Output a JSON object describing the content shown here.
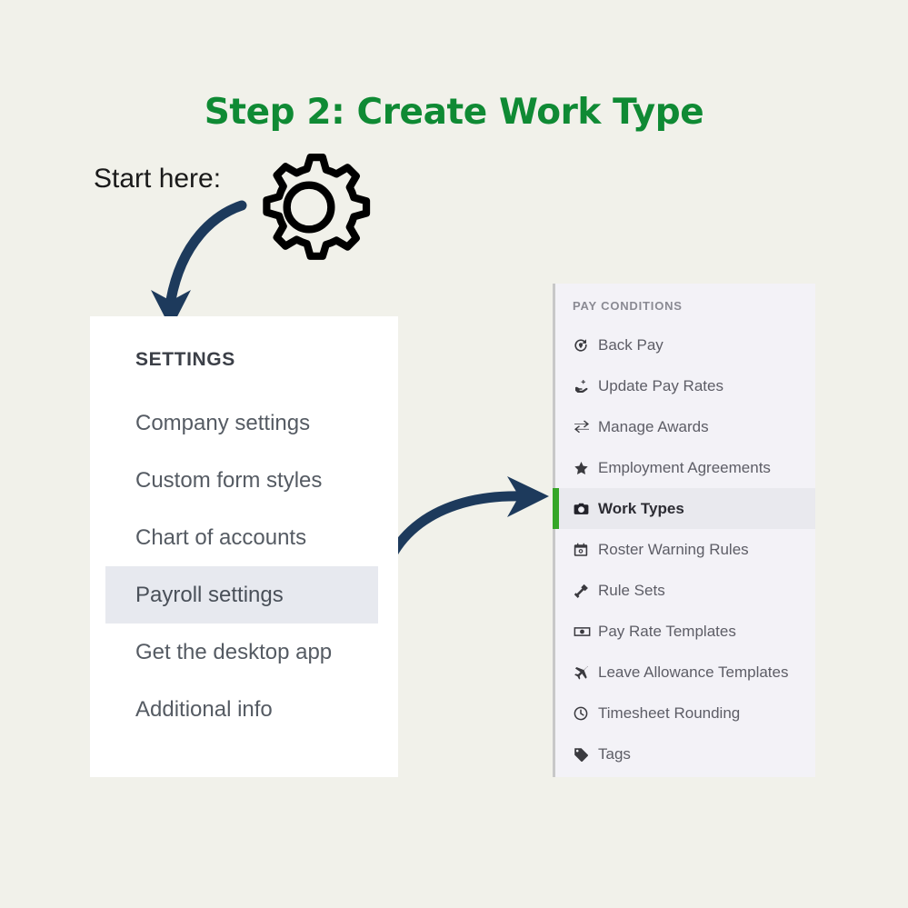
{
  "page": {
    "title": "Step 2: Create Work Type",
    "background_color": "#f1f1ea",
    "title_color": "#0f8a34"
  },
  "annotation": {
    "start_here_label": "Start here:",
    "arrow_color": "#1d3a5c",
    "gear_icon": "gear-icon"
  },
  "settings_panel": {
    "heading": "SETTINGS",
    "items": [
      {
        "label": "Company settings",
        "active": false
      },
      {
        "label": "Custom form styles",
        "active": false
      },
      {
        "label": "Chart of accounts",
        "active": false
      },
      {
        "label": "Payroll settings",
        "active": true
      },
      {
        "label": "Get the desktop app",
        "active": false
      },
      {
        "label": "Additional info",
        "active": false
      }
    ],
    "active_background": "#e7e9ef"
  },
  "pay_conditions_panel": {
    "heading": "PAY CONDITIONS",
    "accent_color": "#36a628",
    "background": "#f3f2f7",
    "items": [
      {
        "label": "Back Pay",
        "icon": "history-back-pay-icon",
        "active": false
      },
      {
        "label": "Update Pay Rates",
        "icon": "hand-plus-icon",
        "active": false
      },
      {
        "label": "Manage Awards",
        "icon": "exchange-arrows-icon",
        "active": false
      },
      {
        "label": "Employment Agreements",
        "icon": "star-icon",
        "active": false
      },
      {
        "label": "Work Types",
        "icon": "briefcase-camera-icon",
        "active": true
      },
      {
        "label": "Roster Warning Rules",
        "icon": "calendar-clock-icon",
        "active": false
      },
      {
        "label": "Rule Sets",
        "icon": "gavel-icon",
        "active": false
      },
      {
        "label": "Pay Rate Templates",
        "icon": "banknote-icon",
        "active": false
      },
      {
        "label": "Leave Allowance Templates",
        "icon": "airplane-icon",
        "active": false
      },
      {
        "label": "Timesheet Rounding",
        "icon": "clock-icon",
        "active": false
      },
      {
        "label": "Tags",
        "icon": "tag-icon",
        "active": false
      }
    ]
  }
}
